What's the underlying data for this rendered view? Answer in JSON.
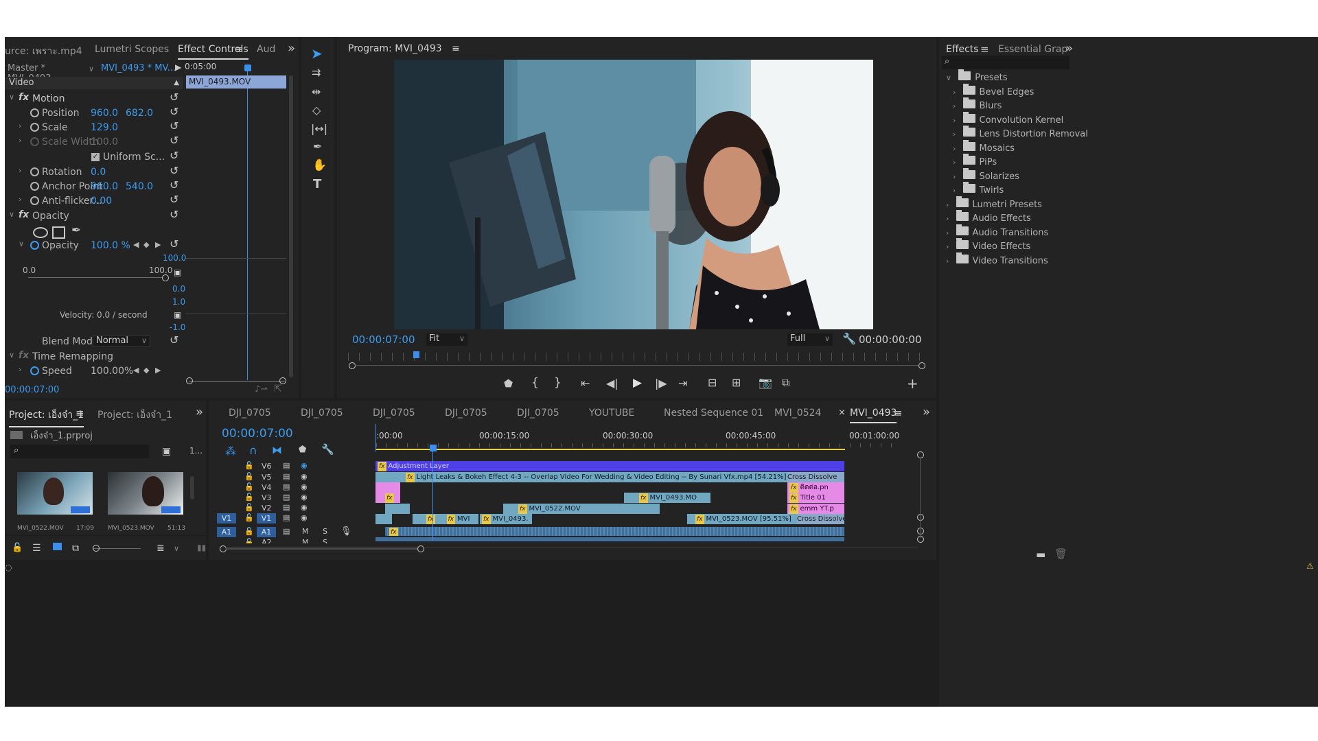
{
  "source_panel": {
    "tabs": [
      "urce: เพราะ.mp4",
      "Lumetri Scopes",
      "Effect Controls",
      "Aud"
    ],
    "active_tab": "Effect Controls",
    "master_label": "Master * MVI_0493...",
    "clip_label": "MVI_0493 * MV...",
    "timecode_header": "0:05:00",
    "clip_bar": "MVI_0493.MOV",
    "section_video": "Video",
    "motion": "Motion",
    "position_label": "Position",
    "position_x": "960.0",
    "position_y": "682.0",
    "scale_label": "Scale",
    "scale_value": "129.0",
    "scale_width_label": "Scale Width",
    "scale_width_value": "100.0",
    "uniform_scale": "Uniform Sc...",
    "rotation_label": "Rotation",
    "rotation_value": "0.0",
    "anchor_label": "Anchor Point",
    "anchor_x": "960.0",
    "anchor_y": "540.0",
    "antiflicker_label": "Anti-flicker...",
    "antiflicker_value": "0.00",
    "opacity_section": "Opacity",
    "opacity_label": "Opacity",
    "opacity_value": "100.0 %",
    "graph_top": "100.0",
    "slider_min": "0.0",
    "slider_max": "100.0",
    "graph_zero": "0.0",
    "velocity_top": "1.0",
    "velocity_label": "Velocity: 0.0 / second",
    "velocity_bottom": "-1.0",
    "blend_label": "Blend Mode",
    "blend_value": "Normal",
    "time_remap": "Time Remapping",
    "speed_label": "Speed",
    "speed_value": "100.00%",
    "current_time": "00:00:07:00"
  },
  "program_monitor": {
    "title": "Program: MVI_0493",
    "timecode": "00:00:07:00",
    "fit": "Fit",
    "quality": "Full",
    "duration": "00:00:00:00"
  },
  "effects_panel": {
    "tabs": [
      "Effects",
      "Essential Grap"
    ],
    "tree": [
      {
        "label": "Presets",
        "level": 0,
        "open": true
      },
      {
        "label": "Bevel Edges",
        "level": 1
      },
      {
        "label": "Blurs",
        "level": 1
      },
      {
        "label": "Convolution Kernel",
        "level": 1
      },
      {
        "label": "Lens Distortion Removal",
        "level": 1
      },
      {
        "label": "Mosaics",
        "level": 1
      },
      {
        "label": "PiPs",
        "level": 1
      },
      {
        "label": "Solarizes",
        "level": 1
      },
      {
        "label": "Twirls",
        "level": 1
      },
      {
        "label": "Lumetri Presets",
        "level": 0
      },
      {
        "label": "Audio Effects",
        "level": 0
      },
      {
        "label": "Audio Transitions",
        "level": 0
      },
      {
        "label": "Video Effects",
        "level": 0
      },
      {
        "label": "Video Transitions",
        "level": 0
      }
    ]
  },
  "project_panel": {
    "tabs": [
      "Project: เอ็งจ๋า_1",
      "Project: เอ็งจ๋า_1"
    ],
    "file": "เอ็งจ๋า_1.prproj",
    "count": "1...",
    "thumbs": [
      {
        "name": "MVI_0522.MOV",
        "duration": "17:09"
      },
      {
        "name": "MVI_0523.MOV",
        "duration": "51:13"
      }
    ]
  },
  "timeline": {
    "tabs": [
      "DJI_0705",
      "DJI_0705",
      "DJI_0705",
      "DJI_0705",
      "DJI_0705",
      "YOUTUBE",
      "Nested Sequence 01",
      "MVI_0524",
      "MVI_0493"
    ],
    "active_tab": "MVI_0493",
    "timecode": "00:00:07:00",
    "ruler": [
      ":00:00",
      "00:00:15:00",
      "00:00:30:00",
      "00:00:45:00",
      "00:01:00:00"
    ],
    "tracks": [
      "V6",
      "V5",
      "V4",
      "V3",
      "V2",
      "V1",
      "A1",
      "A2"
    ],
    "clips": {
      "v6": "Adjustment Layer",
      "v5": "Light Leaks & Bokeh Effect 4-3 -- Overlap Video For Wedding & Video Editing -- By Sunari Vfx.mp4 [54.21%]",
      "v5_end": "Cross Dissolve",
      "v4_end": "ติดต่อ.pn",
      "v3_mid": "MVI_0493.MO",
      "v3_end": "Title 01",
      "v2_mid": "MVI_0522.MOV",
      "v2_end": "emm YT.p",
      "v1_a": "MVI",
      "v1_b": "MVI_0493.",
      "v1_c": "MVI_0523.MOV [95.51%]",
      "v1_end": "Cross Dissolve"
    }
  }
}
